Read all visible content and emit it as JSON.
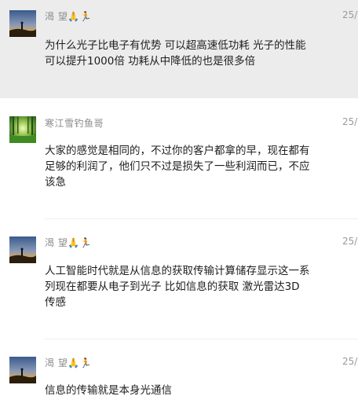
{
  "messages": [
    {
      "name": "渴 望🙏🏃",
      "time": "25/",
      "text": "为什么光子比电子有优势  可以超高速低功耗 光子的性能\n可以提升1000倍 功耗从中降低的也是很多倍",
      "avatar": "sunset-avatar",
      "highlighted": true
    },
    {
      "name": "寒江雪钓鱼哥",
      "time": "25/",
      "text": "大家的感觉是相同的，不过你的客户都拿的早，现在都有\n足够的利润了，他们只不过是损失了一些利润而已，不应\n该急",
      "avatar": "forest-avatar",
      "highlighted": false
    },
    {
      "name": "渴 望🙏🏃",
      "time": "25/",
      "text": "人工智能时代就是从信息的获取传输计算储存显示这一系\n列现在都要从电子到光子  比如信息的获取 激光雷达3D\n传感",
      "avatar": "sunset-avatar",
      "highlighted": false
    },
    {
      "name": "渴 望🙏🏃",
      "time": "25/",
      "text": "信息的传输就是本身光通信",
      "avatar": "sunset-avatar",
      "highlighted": false
    }
  ]
}
